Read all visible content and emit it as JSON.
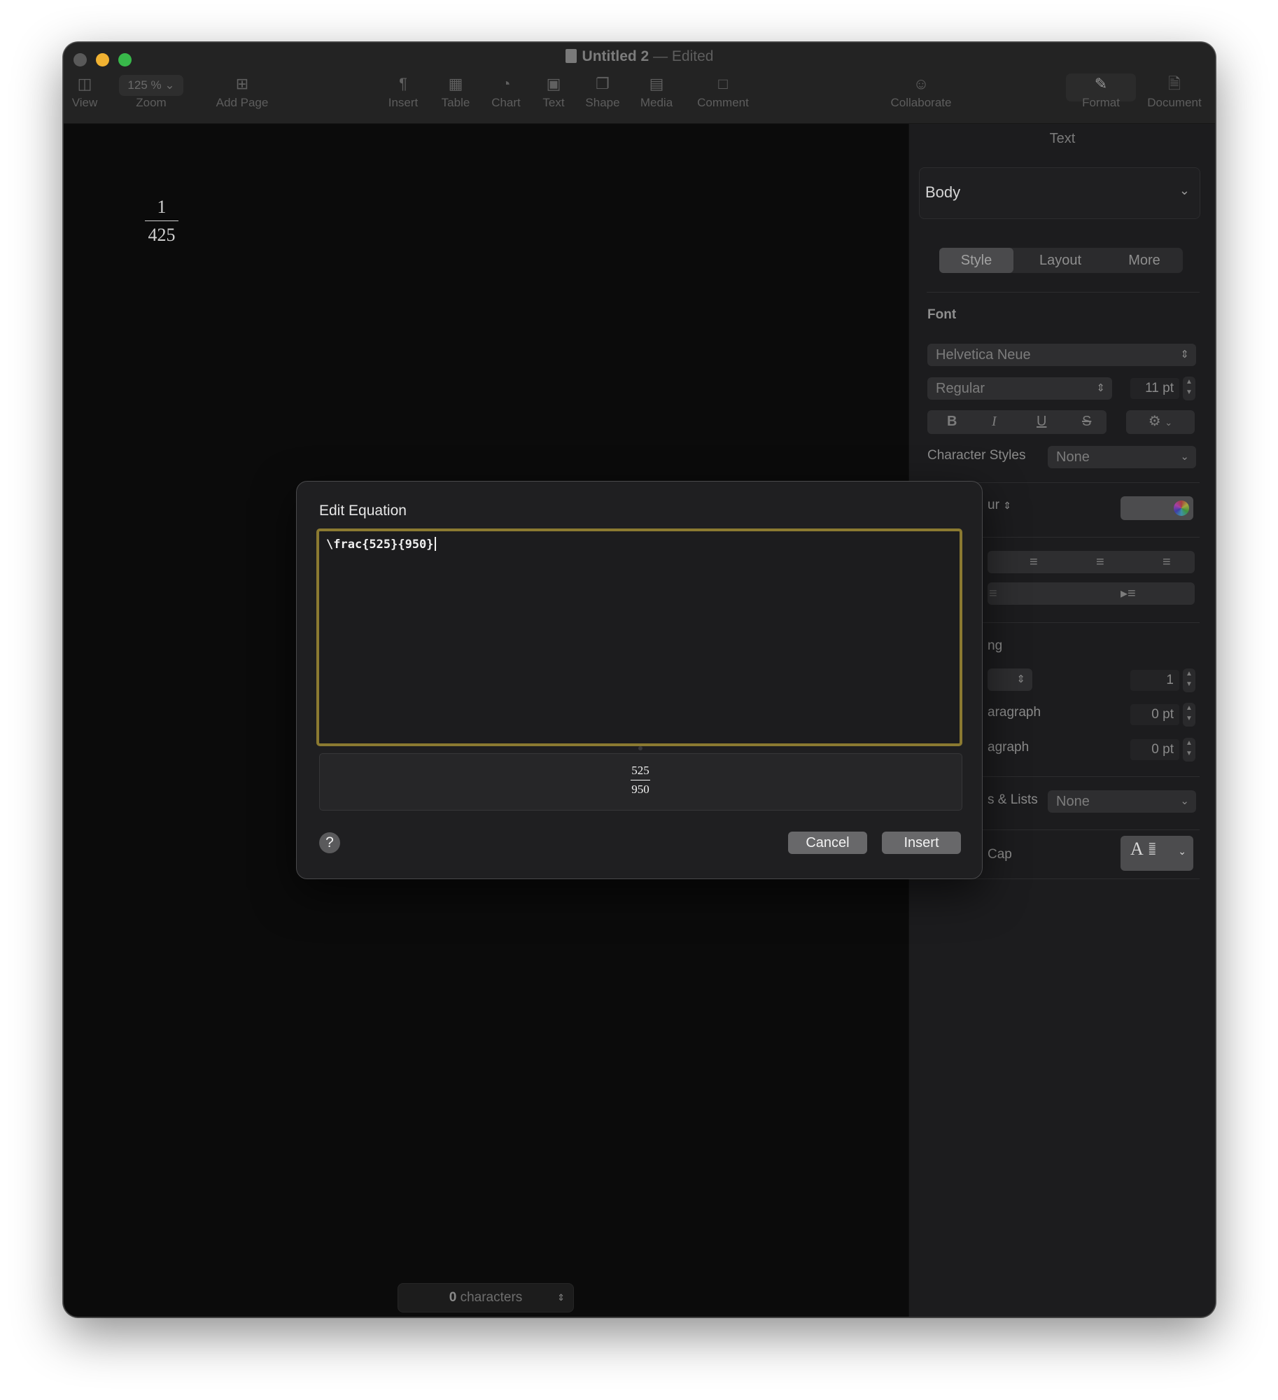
{
  "window": {
    "title": "Untitled 2",
    "title_separator": "—",
    "title_status": "Edited"
  },
  "toolbar": {
    "view": {
      "label": "View",
      "icon": "sidebar-icon"
    },
    "zoom": {
      "label": "Zoom",
      "value": "125 %",
      "icon": "chevron-down-icon"
    },
    "add_page": {
      "label": "Add Page",
      "icon": "plus-square-icon"
    },
    "insert": {
      "label": "Insert",
      "icon": "pilcrow-icon"
    },
    "table": {
      "label": "Table",
      "icon": "table-icon"
    },
    "chart": {
      "label": "Chart",
      "icon": "pie-chart-icon"
    },
    "text": {
      "label": "Text",
      "icon": "text-box-icon"
    },
    "shape": {
      "label": "Shape",
      "icon": "shape-icon"
    },
    "media": {
      "label": "Media",
      "icon": "photo-icon"
    },
    "comment": {
      "label": "Comment",
      "icon": "speech-bubble-icon"
    },
    "collaborate": {
      "label": "Collaborate",
      "icon": "collaborate-icon"
    },
    "format": {
      "label": "Format",
      "icon": "paintbrush-icon"
    },
    "document": {
      "label": "Document",
      "icon": "document-icon"
    }
  },
  "canvas": {
    "equation": {
      "numerator": "1",
      "denominator": "425"
    },
    "char_count_value": "0",
    "char_count_label": "characters"
  },
  "sidebar": {
    "title": "Text",
    "paragraph_style": "Body",
    "tabs": [
      "Style",
      "Layout",
      "More"
    ],
    "active_tab": "Style",
    "font_heading": "Font",
    "font_family": "Helvetica Neue",
    "font_typeface": "Regular",
    "font_size": "11 pt",
    "format_buttons": [
      "B",
      "I",
      "U",
      "S"
    ],
    "character_styles_label": "Character Styles",
    "character_styles_value": "None",
    "text_colour_label_partial": "ur",
    "spacing_label_partial": "ng",
    "spacing_value": "1",
    "before_paragraph_label_partial": "aragraph",
    "before_paragraph_value": "0 pt",
    "after_paragraph_label_partial": "agraph",
    "after_paragraph_value": "0 pt",
    "bullets_lists_label_partial": "s & Lists",
    "bullets_lists_value": "None",
    "drop_cap_label_partial": "Cap",
    "drop_cap_glyph": "A"
  },
  "dialog": {
    "title": "Edit Equation",
    "latex": "\\frac{525}{950}",
    "preview": {
      "numerator": "525",
      "denominator": "950"
    },
    "help_label": "?",
    "cancel_label": "Cancel",
    "insert_label": "Insert",
    "accent_color": "#8b7a31"
  }
}
